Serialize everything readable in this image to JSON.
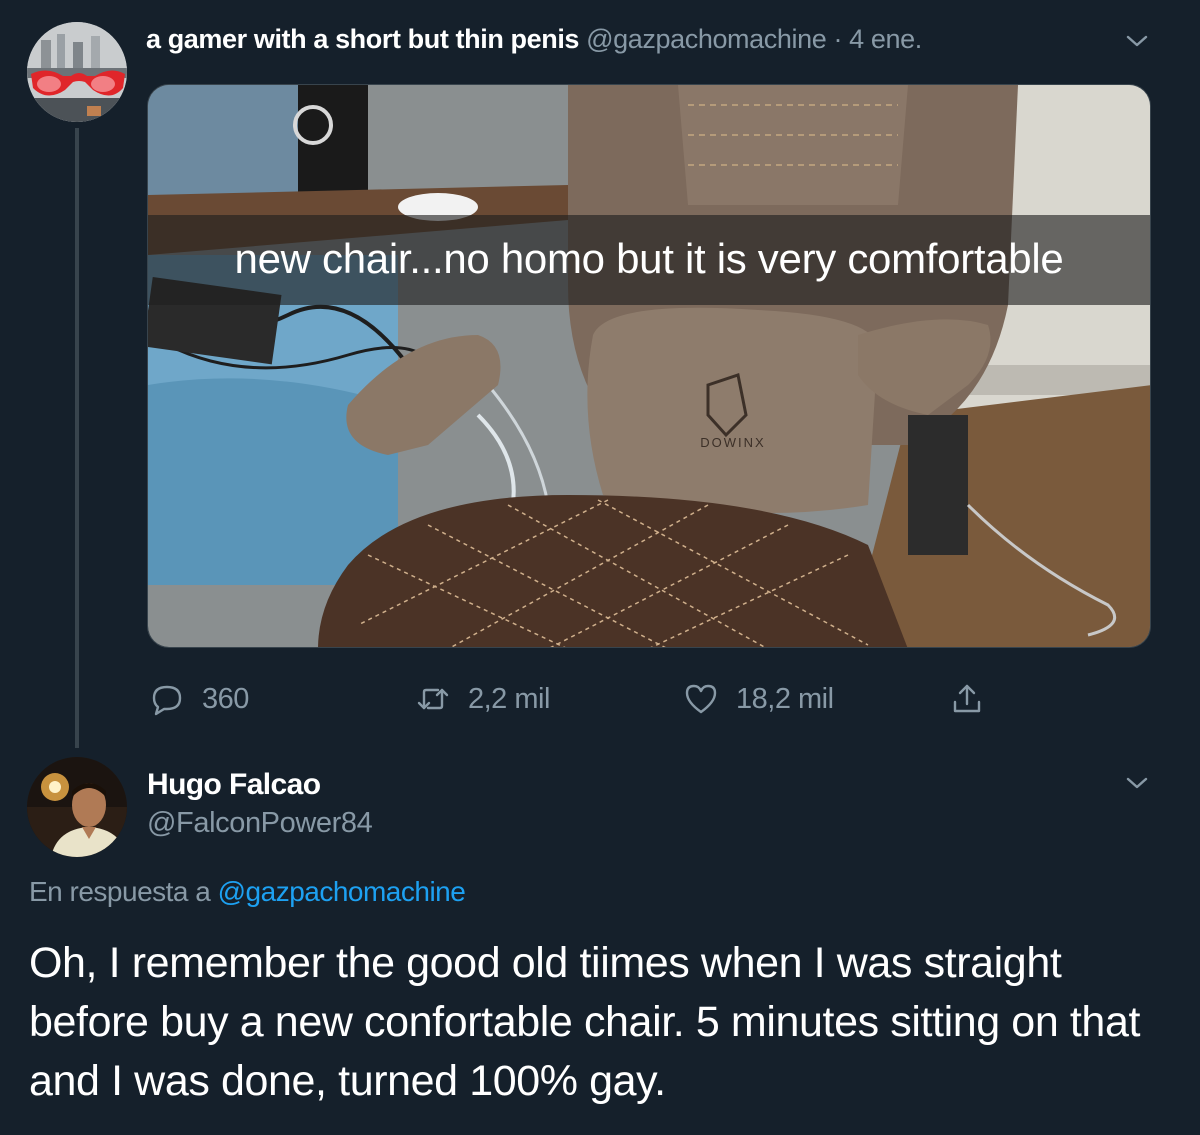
{
  "tweet": {
    "display_name": "a gamer with a short but thin penis",
    "handle": "@gazpachomachine",
    "separator": "·",
    "date": "4 ene.",
    "image_caption": "new chair...no homo but it is very comfortable",
    "image_brand": "DOWINX",
    "replies": "360",
    "retweets": "2,2 mil",
    "likes": "18,2 mil"
  },
  "reply": {
    "display_name": "Hugo Falcao",
    "handle": "@FalconPower84",
    "in_reply_prefix": "En respuesta a",
    "in_reply_to": "@gazpachomachine",
    "text": "Oh, I remember the good old tiimes when I was straight before buy a new confortable chair. 5 minutes sitting on that and I was done, turned 100% gay."
  },
  "icons": {
    "reply": "reply-bubble-icon",
    "retweet": "retweet-icon",
    "like": "heart-icon",
    "share": "share-upload-icon",
    "menu": "chevron-down-icon"
  },
  "colors": {
    "background": "#15202b",
    "muted_text": "#8899a6",
    "link": "#1da1f2",
    "border": "#38444d"
  }
}
